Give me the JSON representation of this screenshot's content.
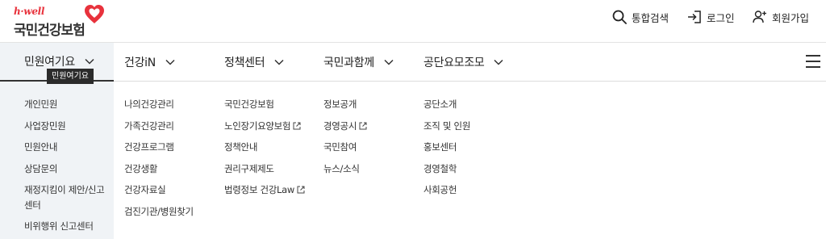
{
  "header": {
    "logo": {
      "tagline": "h·well",
      "name": "국민건강보험"
    },
    "utility": {
      "search": {
        "label": "통합검색",
        "icon": "search-icon"
      },
      "login": {
        "label": "로그인",
        "icon": "login-icon"
      },
      "join": {
        "label": "회원가입",
        "icon": "user-plus-icon"
      }
    }
  },
  "nav": {
    "items": [
      {
        "label": "민원여기요"
      },
      {
        "label": "건강iN"
      },
      {
        "label": "정책센터"
      },
      {
        "label": "국민과함께"
      },
      {
        "label": "공단요모조모"
      }
    ],
    "menu_icon": "hamburger-icon"
  },
  "tooltip": "민원여기요",
  "columns": [
    [
      "개인민원",
      "사업장민원",
      "민원안내",
      "상담문의",
      "재정지킴이 제안/신고센터",
      "비위행위 신고센터"
    ],
    [
      "나의건강관리",
      "가족건강관리",
      "건강프로그램",
      "건강생활",
      "건강자료실",
      "검진기관/병원찾기"
    ],
    [
      "국민건강보험",
      "노인장기요양보험",
      "정책안내",
      "권리구제제도",
      "법령정보 건강Law"
    ],
    [
      "정보공개",
      "경영공시",
      "국민참여",
      "뉴스/소식"
    ],
    [
      "공단소개",
      "조직 및 인원",
      "홍보센터",
      "경영철학",
      "사회공헌"
    ]
  ],
  "colors": {
    "brand_red": "#e8323c",
    "active_bg": "#f0f3f6"
  }
}
